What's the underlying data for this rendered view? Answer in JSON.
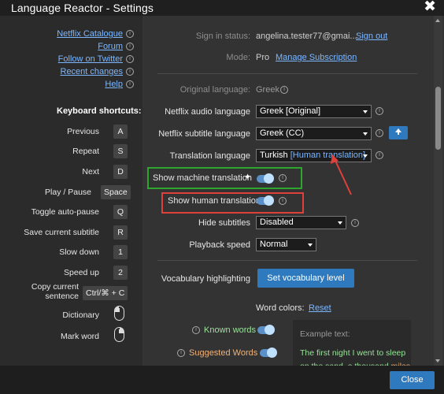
{
  "window": {
    "title": "Language Reactor - Settings",
    "close_label": "✖"
  },
  "sidebar": {
    "links": [
      {
        "label": "Netflix Catalogue"
      },
      {
        "label": "Forum"
      },
      {
        "label": "Follow on Twitter"
      },
      {
        "label": "Recent changes"
      },
      {
        "label": "Help"
      }
    ],
    "shortcuts_title": "Keyboard shortcuts:",
    "shortcuts": [
      {
        "label": "Previous",
        "key": "A"
      },
      {
        "label": "Repeat",
        "key": "S"
      },
      {
        "label": "Next",
        "key": "D"
      },
      {
        "label": "Play / Pause",
        "key": "Space"
      },
      {
        "label": "Toggle auto-pause",
        "key": "Q"
      },
      {
        "label": "Save current subtitle",
        "key": "R"
      },
      {
        "label": "Slow down",
        "key": "1"
      },
      {
        "label": "Speed up",
        "key": "2"
      },
      {
        "label": "Copy current sentence",
        "key": "Ctrl/⌘ + C"
      },
      {
        "label": "Dictionary",
        "icon": "mouse-left-click-icon"
      },
      {
        "label": "Mark word",
        "icon": "mouse-right-click-icon"
      }
    ]
  },
  "account": {
    "signin_label": "Sign in status:",
    "email": "angelina.tester77@gmai...",
    "signout": "Sign out",
    "mode_label": "Mode:",
    "mode_value": "Pro",
    "manage": "Manage Subscription"
  },
  "settings": {
    "original_language_label": "Original language:",
    "original_language_value": "Greek",
    "audio_label": "Netflix audio language",
    "audio_value": "Greek [Original]",
    "subtitle_label": "Netflix subtitle language",
    "subtitle_value": "Greek (CC)",
    "translation_label": "Translation language",
    "translation_value_lang": "Turkish",
    "translation_value_tag": "[Human translation]",
    "machine_label": "Show machine translation",
    "machine_on": true,
    "human_label": "Show human translation",
    "human_on": true,
    "hide_subs_label": "Hide subtitles",
    "hide_subs_value": "Disabled",
    "speed_label": "Playback speed",
    "speed_value": "Normal",
    "vocab_label": "Vocabulary highlighting",
    "vocab_button": "Set vocabulary level",
    "word_colors_label": "Word colors:",
    "reset": "Reset",
    "known_label": "Known words",
    "known_on": true,
    "suggested_label": "Suggested Words",
    "suggested_on": true
  },
  "example": {
    "title": "Example text:",
    "line1": "The first night I went to sleep",
    "line2_a": "on the ",
    "line2_b": "sand",
    "line2_c": ", a thousand ",
    "line2_d": "miles"
  },
  "footer": {
    "close_button": "Close"
  },
  "colors": {
    "accent": "#2f7abf",
    "link": "#7cb7ff",
    "known_word": "#9be29b",
    "suggested_word": "#f0b27a",
    "highlight_green": "#2ea52e",
    "highlight_red": "#e0403a"
  }
}
